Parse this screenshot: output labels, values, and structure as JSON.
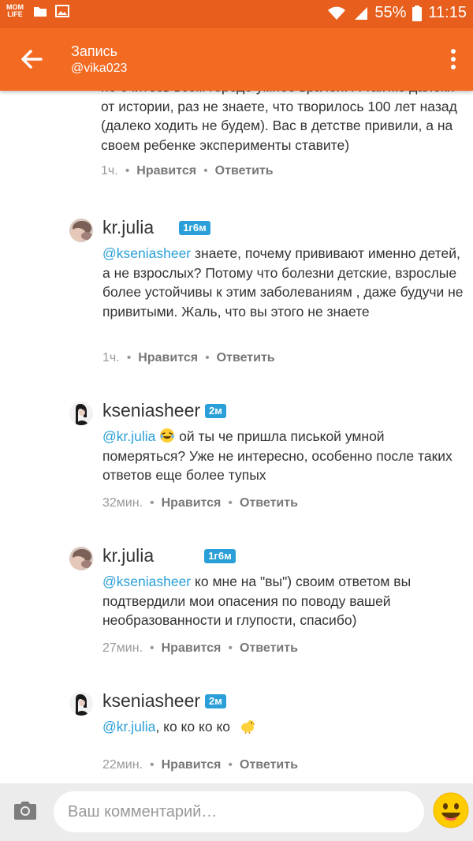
{
  "status_bar": {
    "app_label": "MOM LIFE",
    "battery": "55%",
    "time": "11:15"
  },
  "header": {
    "title": "Запись",
    "subtitle": "@vika023"
  },
  "comments": [
    {
      "partial": true,
      "text_fragment": "не очитесь всем городе умнее врачей. А так же далеки от истории, раз не знаете, что творилось 100 лет назад (далеко ходить не будем). Вас в детстве привили, а на своем ребенке эксперименты ставите)",
      "time": "1ч.",
      "like": "Нравится",
      "reply": "Ответить"
    },
    {
      "author": "kr.julia",
      "badge": "1г6м",
      "mention": "@kseniasheer",
      "text": " знаете, почему прививают именно детей, а не взрослых? Потому что болезни детские, взрослые более устойчивы к этим заболеваниям , даже будучи не привитыми. Жаль, что вы этого не знаете",
      "time": "1ч.",
      "like": "Нравится",
      "reply": "Ответить"
    },
    {
      "author": "kseniasheer",
      "badge": "2м",
      "mention": "@kr.julia",
      "text": " ой ты че пришла писькой умной померяться? Уже не интересно, особенно после таких ответов еще более тупых",
      "emoji": "laughing-tears-emoji",
      "time": "32мин.",
      "like": "Нравится",
      "reply": "Ответить"
    },
    {
      "author": "kr.julia",
      "badge": "1г6м",
      "mention": "@kseniasheer",
      "text": " ко мне на \"вы\") своим ответом вы подтвердили мои опасения по поводу вашей необразованности и глупости, спасибо)",
      "time": "27мин.",
      "like": "Нравится",
      "reply": "Ответить"
    },
    {
      "author": "kseniasheer",
      "badge": "2м",
      "mention": "@kr.julia",
      "text": ", ко ко ко ко ",
      "emoji": "chick-emoji",
      "time": "22мин.",
      "like": "Нравится",
      "reply": "Ответить"
    }
  ],
  "composer": {
    "placeholder": "Ваш комментарий…"
  },
  "colors": {
    "status_bar": "#e85e1c",
    "app_bar": "#f36a22",
    "accent_blue": "#2a9fd8",
    "text": "#333333",
    "muted": "#999999"
  }
}
